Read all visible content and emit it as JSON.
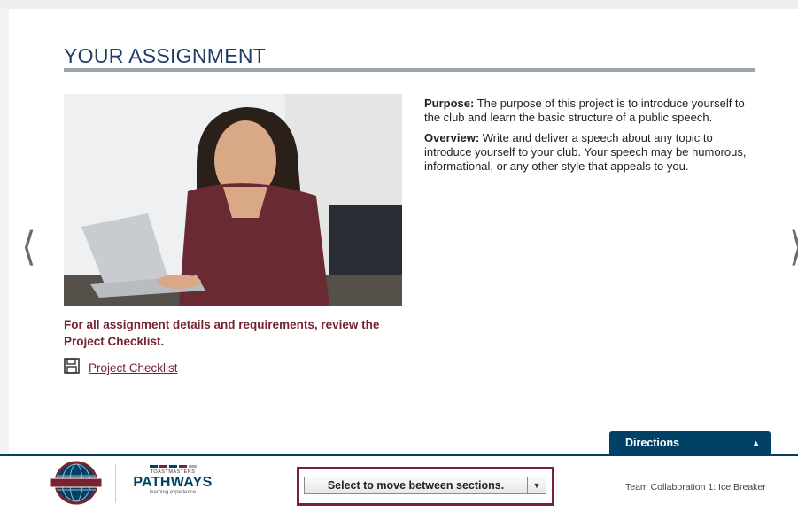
{
  "assignment": {
    "heading": "YOUR ASSIGNMENT",
    "purpose_label": "Purpose:",
    "purpose_text": " The purpose of this project is to introduce yourself to the club and learn the basic structure of a public speech.",
    "overview_label": "Overview:",
    "overview_text": " Write and deliver a speech about any topic to introduce yourself to your club. Your speech may be humorous, informational, or any other style that appeals to you.",
    "note": "For all assignment details and requirements, review the Project Checklist.",
    "checklist_link": "Project Checklist",
    "checklist_icon": "floppy-disk-icon",
    "photo_description": "woman-smiling-at-laptop"
  },
  "nav": {
    "prev_glyph": "❬",
    "next_glyph": "❭"
  },
  "directions": {
    "label": "Directions",
    "toggle_glyph": "▲"
  },
  "footer": {
    "pathways_top": "TOASTMASTERS",
    "pathways_word": "PATHWAYS",
    "pathways_sub": "learning experience",
    "logo_text": "TOASTMASTERS",
    "section_select": "Select to move between sections.",
    "section_select_arrow": "▼",
    "course_title": "Team Collaboration 1: Ice Breaker"
  },
  "colors": {
    "brand_blue": "#004165",
    "brand_maroon": "#772432",
    "heading_blue": "#1f3b64"
  }
}
